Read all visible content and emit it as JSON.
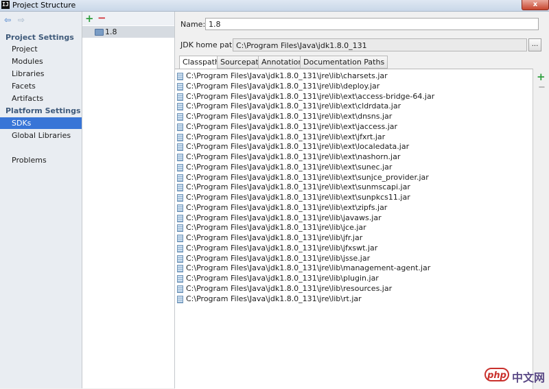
{
  "window": {
    "title": "Project Structure",
    "app_icon": "IJ",
    "close_glyph": "x"
  },
  "nav": {
    "back": "⇦",
    "forward": "⇨"
  },
  "sidebar": {
    "project_settings_header": "Project Settings",
    "project_items": [
      "Project",
      "Modules",
      "Libraries",
      "Facets",
      "Artifacts"
    ],
    "platform_settings_header": "Platform Settings",
    "platform_items": [
      "SDKs",
      "Global Libraries"
    ],
    "other_items": [
      "Problems"
    ],
    "selected": "SDKs"
  },
  "sdk_list": {
    "add": "+",
    "remove": "−",
    "items": [
      "1.8"
    ]
  },
  "detail": {
    "name_label": "Name:",
    "name_value": "1.8",
    "jdk_home_label": "JDK home path:",
    "jdk_home_value": "C:\\Program Files\\Java\\jdk1.8.0_131",
    "browse_label": "..."
  },
  "tabs": [
    "Classpath",
    "Sourcepath",
    "Annotations",
    "Documentation Paths"
  ],
  "active_tab": "Classpath",
  "classpath": [
    "C:\\Program Files\\Java\\jdk1.8.0_131\\jre\\lib\\charsets.jar",
    "C:\\Program Files\\Java\\jdk1.8.0_131\\jre\\lib\\deploy.jar",
    "C:\\Program Files\\Java\\jdk1.8.0_131\\jre\\lib\\ext\\access-bridge-64.jar",
    "C:\\Program Files\\Java\\jdk1.8.0_131\\jre\\lib\\ext\\cldrdata.jar",
    "C:\\Program Files\\Java\\jdk1.8.0_131\\jre\\lib\\ext\\dnsns.jar",
    "C:\\Program Files\\Java\\jdk1.8.0_131\\jre\\lib\\ext\\jaccess.jar",
    "C:\\Program Files\\Java\\jdk1.8.0_131\\jre\\lib\\ext\\jfxrt.jar",
    "C:\\Program Files\\Java\\jdk1.8.0_131\\jre\\lib\\ext\\localedata.jar",
    "C:\\Program Files\\Java\\jdk1.8.0_131\\jre\\lib\\ext\\nashorn.jar",
    "C:\\Program Files\\Java\\jdk1.8.0_131\\jre\\lib\\ext\\sunec.jar",
    "C:\\Program Files\\Java\\jdk1.8.0_131\\jre\\lib\\ext\\sunjce_provider.jar",
    "C:\\Program Files\\Java\\jdk1.8.0_131\\jre\\lib\\ext\\sunmscapi.jar",
    "C:\\Program Files\\Java\\jdk1.8.0_131\\jre\\lib\\ext\\sunpkcs11.jar",
    "C:\\Program Files\\Java\\jdk1.8.0_131\\jre\\lib\\ext\\zipfs.jar",
    "C:\\Program Files\\Java\\jdk1.8.0_131\\jre\\lib\\javaws.jar",
    "C:\\Program Files\\Java\\jdk1.8.0_131\\jre\\lib\\jce.jar",
    "C:\\Program Files\\Java\\jdk1.8.0_131\\jre\\lib\\jfr.jar",
    "C:\\Program Files\\Java\\jdk1.8.0_131\\jre\\lib\\jfxswt.jar",
    "C:\\Program Files\\Java\\jdk1.8.0_131\\jre\\lib\\jsse.jar",
    "C:\\Program Files\\Java\\jdk1.8.0_131\\jre\\lib\\management-agent.jar",
    "C:\\Program Files\\Java\\jdk1.8.0_131\\jre\\lib\\plugin.jar",
    "C:\\Program Files\\Java\\jdk1.8.0_131\\jre\\lib\\resources.jar",
    "C:\\Program Files\\Java\\jdk1.8.0_131\\jre\\lib\\rt.jar"
  ],
  "classpath_tools": {
    "add": "+",
    "remove": "−"
  },
  "watermark": {
    "badge": "php",
    "text": "中文网"
  },
  "colors": {
    "selection": "#3875d7",
    "add": "#2e9e3d",
    "remove": "#d1333a"
  }
}
